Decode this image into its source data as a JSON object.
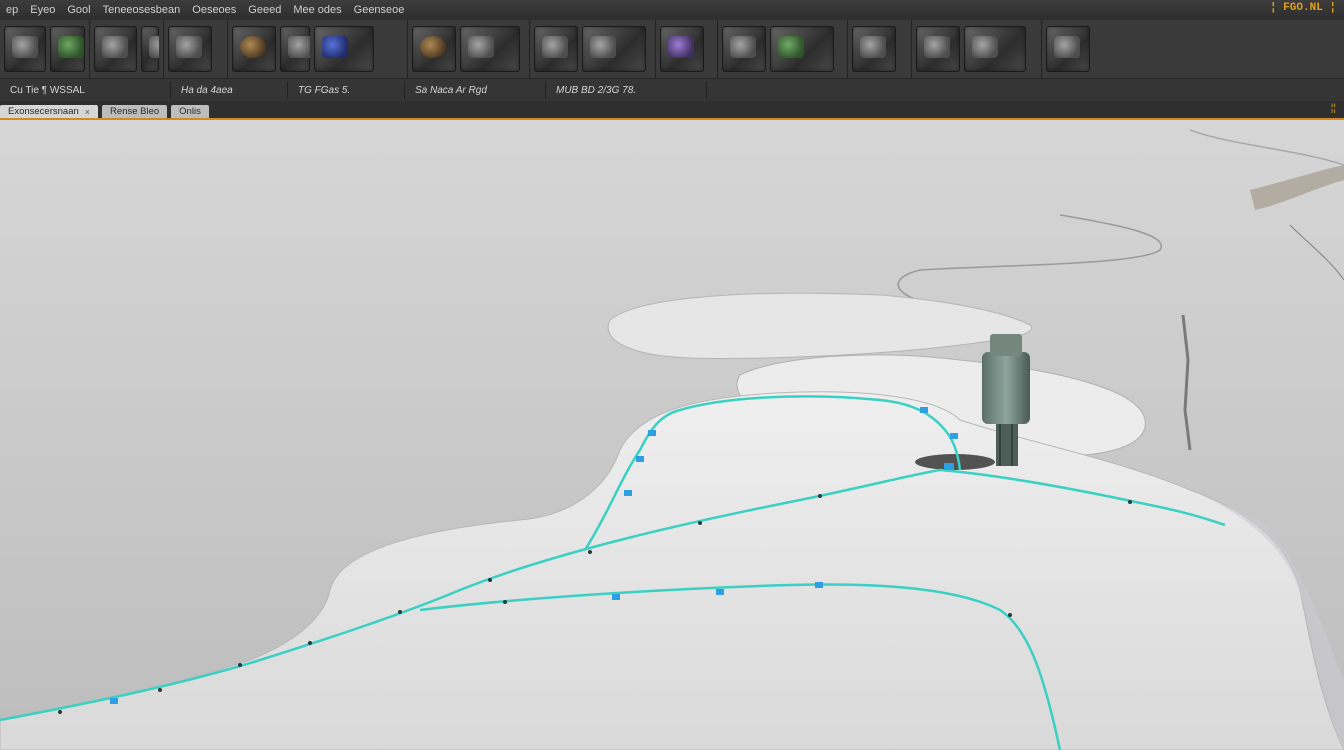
{
  "menubar": {
    "items": [
      "ep",
      "Eyeo",
      "Gool",
      "Teneeosesbean",
      "Oeseoes",
      "Geeed",
      "Mee odes",
      "Geenseoe"
    ],
    "logo": "¦ FGO.NL ¦"
  },
  "shelf": {
    "groups": [
      {
        "thumbs": [
          "tool-thumb",
          "tool-thumb",
          "tool-thumb-green"
        ]
      },
      {
        "thumbs": [
          "tool-thumb-bronze",
          "tool-thumb",
          "tool-thumb-blue"
        ]
      },
      {
        "thumbs": [
          "tool-thumb-bronze",
          "tool-thumb"
        ]
      },
      {
        "thumbs": [
          "tool-thumb",
          "tool-thumb"
        ]
      },
      {
        "thumbs": [
          "tool-thumb-purple"
        ]
      },
      {
        "thumbs": [
          "tool-thumb",
          "tool-thumb"
        ]
      },
      {
        "thumbs": [
          "tool-thumb"
        ]
      },
      {
        "thumbs": [
          "tool-thumb",
          "tool-thumb"
        ]
      }
    ]
  },
  "toolbar": {
    "buttons": [
      "Cu Tie ¶ WSSAL",
      "Ha da 4aea",
      "TG FGas 5.",
      "Sa Naca Ar Rgd",
      "MUB BD 2/3G 78.",
      ""
    ]
  },
  "tabs": [
    {
      "label": "Exonsecersnaan",
      "close": "×"
    },
    {
      "label": "Rense Bleo"
    },
    {
      "label": "Onlis"
    }
  ],
  "tabrow_icon": "¦¦",
  "viewport": {
    "accent_color": "#3ad0c4",
    "terrain_color": "#e4e4e4",
    "background_color": "#c9c9c9"
  }
}
